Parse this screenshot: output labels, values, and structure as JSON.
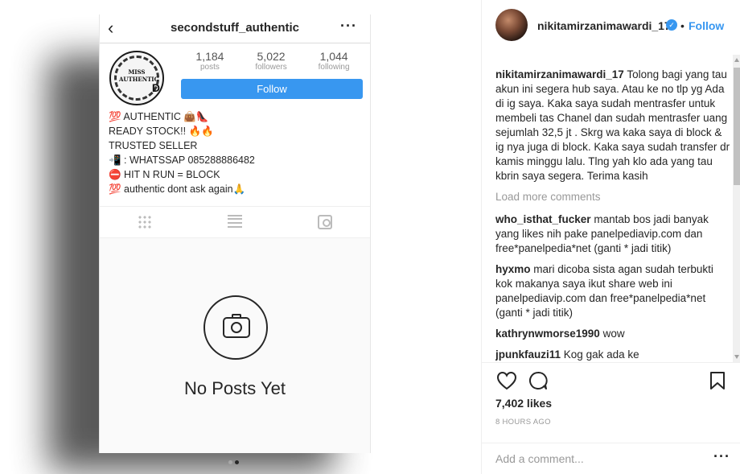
{
  "phone": {
    "username": "secondstuff_authentic",
    "back": "‹",
    "more": "···",
    "avatar_text": "MISS AUTHENTIC",
    "avatar_letter": "D",
    "stats": [
      {
        "value": "1,184",
        "label": "posts"
      },
      {
        "value": "5,022",
        "label": "followers"
      },
      {
        "value": "1,044",
        "label": "following"
      }
    ],
    "follow_label": "Follow",
    "bio": [
      "💯 AUTHENTIC 👜👠",
      "READY STOCK!! 🔥🔥",
      "TRUSTED SELLER",
      "📲 : WHATSSAP 085288886482",
      "⛔ HIT N RUN = BLOCK",
      "💯 authentic dont ask again🙏"
    ],
    "no_posts": "No Posts Yet"
  },
  "post": {
    "author": "nikitamirzanimawardi_17",
    "verified_mark": "✓",
    "separator": "•",
    "follow_label": "Follow",
    "caption_user": "nikitamirzanimawardi_17",
    "caption_text": "Tolong bagi yang tau akun ini segera hub saya. Atau ke no tlp yg Ada di ig saya. Kaka saya sudah mentrasfer untuk membeli tas Chanel dan sudah mentrasfer uang sejumlah 32,5 jt . Skrg wa kaka saya di block & ig nya juga di block. Kaka saya sudah transfer dr kamis minggu lalu. Tlng yah klo ada yang tau kbrin saya segera. Terima kasih",
    "load_more": "Load more comments",
    "comments": [
      {
        "user": "who_isthat_fucker",
        "text": "mantab bos jadi banyak yang likes nih pake panelpediavip.com dan free*panelpedia*net (ganti * jadi titik)"
      },
      {
        "user": "hyxmo",
        "text": "mari dicoba sista agan sudah terbukti kok makanya saya ikut share web ini panelpediavip.com dan free*panelpedia*net (ganti * jadi titik)"
      },
      {
        "user": "kathrynwmorse1990",
        "text": "wow"
      },
      {
        "user": "jpunkfauzi11",
        "text": "Kog gak ada ke"
      }
    ],
    "likes": "7,402 likes",
    "time_ago": "8 HOURS AGO",
    "add_comment_placeholder": "Add a comment...",
    "more": "···"
  }
}
